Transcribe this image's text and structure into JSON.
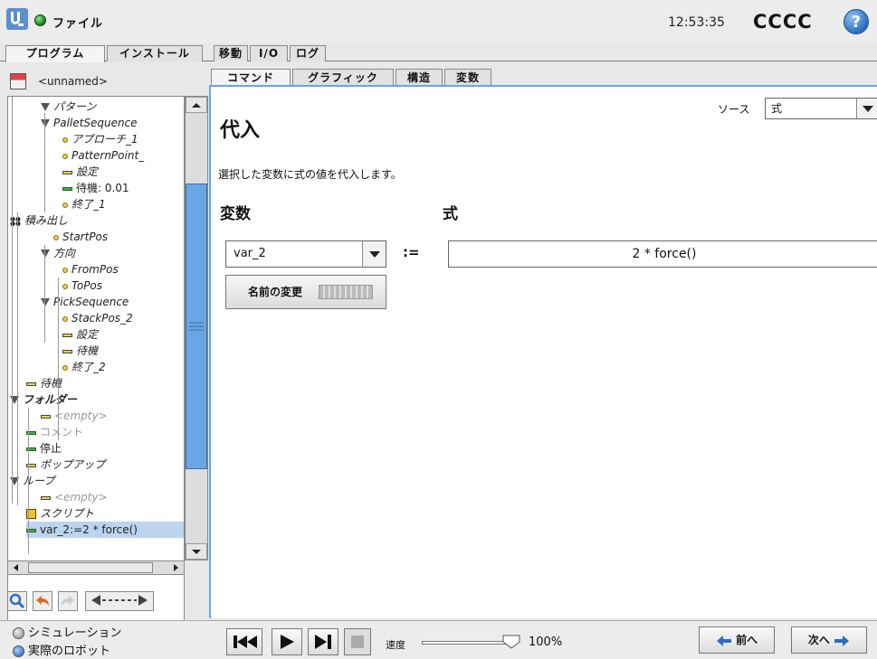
{
  "header": {
    "file_menu": "ファイル",
    "time": "12:53:35",
    "robot_name": "CCCC",
    "help_glyph": "?",
    "status_color": "#1e8a1e"
  },
  "main_tabs": [
    "プログラム",
    "インストール",
    "移動",
    "I/O",
    "ログ"
  ],
  "program": {
    "file_name": "<unnamed>"
  },
  "sub_tabs": [
    "コマンド",
    "グラフィック",
    "構造",
    "変数"
  ],
  "tree": [
    {
      "label": "パターン",
      "icon": "triangle-icon"
    },
    {
      "label": "PalletSequence",
      "icon": "triangle-icon"
    },
    {
      "label": "アプローチ_1",
      "icon": "waypoint-icon"
    },
    {
      "label": "PatternPoint_",
      "icon": "waypoint-icon"
    },
    {
      "label": "設定",
      "icon": "bar-icon"
    },
    {
      "label": "待機: 0.01",
      "icon": "bar-green-icon"
    },
    {
      "label": "終了_1",
      "icon": "waypoint-icon"
    },
    {
      "label": "積み出し",
      "icon": "pallet-icon"
    },
    {
      "label": "StartPos",
      "icon": "waypoint-icon"
    },
    {
      "label": "方向",
      "icon": "triangle-icon"
    },
    {
      "label": "FromPos",
      "icon": "waypoint-icon"
    },
    {
      "label": "ToPos",
      "icon": "waypoint-icon"
    },
    {
      "label": "PickSequence",
      "icon": "triangle-icon"
    },
    {
      "label": "StackPos_2",
      "icon": "waypoint-icon"
    },
    {
      "label": "設定",
      "icon": "bar-icon"
    },
    {
      "label": "待機",
      "icon": "bar-icon"
    },
    {
      "label": "終了_2",
      "icon": "waypoint-icon"
    },
    {
      "label": "待機",
      "icon": "bar-icon"
    },
    {
      "label": "フォルダー",
      "icon": "triangle-icon"
    },
    {
      "label": "<empty>",
      "icon": "bar-icon"
    },
    {
      "label": "コメント",
      "icon": "bar-green-icon"
    },
    {
      "label": "停止",
      "icon": "bar-green-icon"
    },
    {
      "label": "ポップアップ",
      "icon": "bar-icon"
    },
    {
      "label": "ループ",
      "icon": "triangle-icon"
    },
    {
      "label": "<empty>",
      "icon": "bar-icon"
    },
    {
      "label": "スクリプト",
      "icon": "script-icon"
    },
    {
      "label": "var_2:=2 * force()",
      "icon": "bar-green-icon"
    }
  ],
  "panel": {
    "title": "代入",
    "source_label": "ソース",
    "source_value": "式",
    "description": "選択した変数に式の値を代入します。",
    "variable_heading": "変数",
    "expression_heading": "式",
    "variable_value": "var_2",
    "assign_symbol": ":=",
    "expression_value": "2 * force()",
    "rename_button": "名前の変更"
  },
  "bottom": {
    "simulation_label": "シミュレーション",
    "real_robot_label": "実際のロボット",
    "speed_label": "速度",
    "speed_value": "100%",
    "speed_fraction": 1.0,
    "prev_button": "前へ",
    "next_button": "次へ"
  }
}
